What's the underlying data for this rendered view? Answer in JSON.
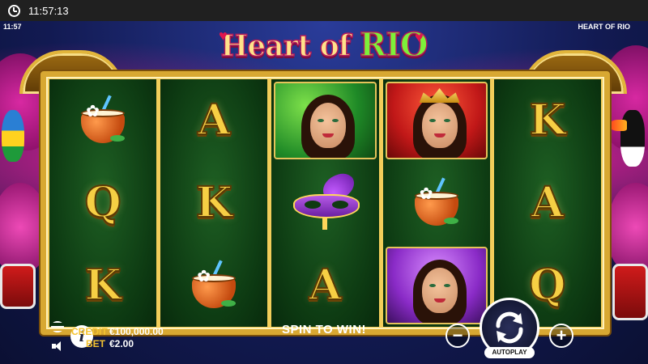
{
  "status_bar": {
    "time": "11:57:13"
  },
  "game": {
    "small_time": "11:57",
    "name_small": "HEART OF RIO",
    "title_part1": "Heart of",
    "title_part2": "RIO"
  },
  "reels": [
    [
      {
        "type": "symbol",
        "icon": "coconut-drink-icon"
      },
      {
        "type": "letter",
        "text": "Q"
      },
      {
        "type": "letter",
        "text": "K"
      }
    ],
    [
      {
        "type": "letter",
        "text": "A"
      },
      {
        "type": "letter",
        "text": "K"
      },
      {
        "type": "symbol",
        "icon": "coconut-drink-icon"
      }
    ],
    [
      {
        "type": "portrait",
        "icon": "green-dancer-icon"
      },
      {
        "type": "symbol",
        "icon": "carnival-mask-icon"
      },
      {
        "type": "letter",
        "text": "A"
      }
    ],
    [
      {
        "type": "portrait",
        "icon": "red-queen-icon"
      },
      {
        "type": "symbol",
        "icon": "coconut-drink-icon"
      },
      {
        "type": "portrait",
        "icon": "purple-dancer-icon"
      }
    ],
    [
      {
        "type": "letter",
        "text": "K"
      },
      {
        "type": "letter",
        "text": "A"
      },
      {
        "type": "letter",
        "text": "Q"
      }
    ]
  ],
  "bottom_bar": {
    "credit_label": "CREDIT",
    "credit_value": "€100,000.00",
    "bet_label": "BET",
    "bet_value": "€2.00",
    "message": "SPIN TO WIN!",
    "minus_symbol": "−",
    "plus_symbol": "+",
    "autoplay_label": "AUTOPLAY",
    "info_symbol": "i"
  },
  "colors": {
    "frame_gold": "#d8a832",
    "label_gold": "#f5c330",
    "reel_green": "#0d3a12",
    "title_green": "#7df03a"
  }
}
